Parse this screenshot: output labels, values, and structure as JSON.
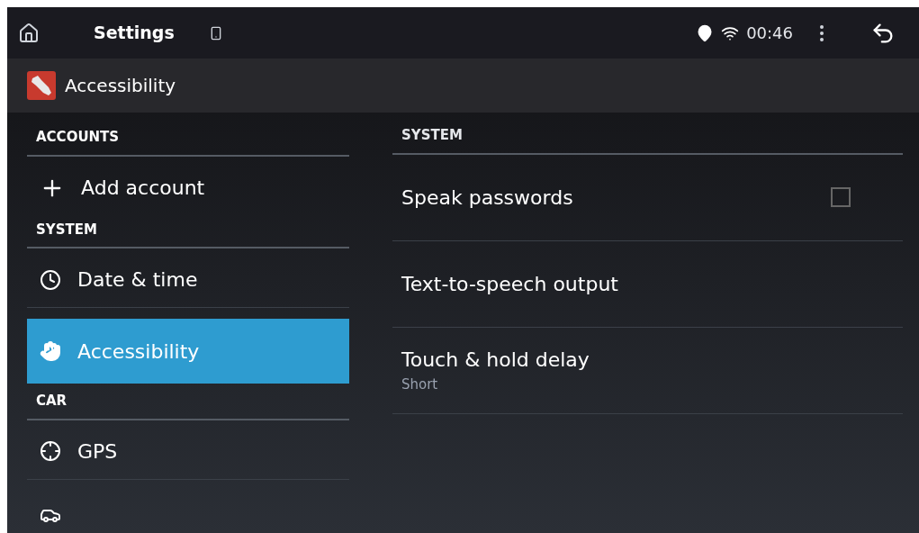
{
  "status_bar": {
    "title": "Settings",
    "time": "00:46"
  },
  "action_bar": {
    "title": "Accessibility"
  },
  "sidebar": {
    "sections": [
      {
        "header": "ACCOUNTS",
        "items": [
          {
            "kind": "add",
            "label": "Add account",
            "selected": false
          }
        ]
      },
      {
        "header": "SYSTEM",
        "items": [
          {
            "kind": "clock",
            "label": "Date & time",
            "selected": false
          },
          {
            "kind": "hand",
            "label": "Accessibility",
            "selected": true
          }
        ]
      },
      {
        "header": "CAR",
        "items": [
          {
            "kind": "gps",
            "label": "GPS",
            "selected": false
          },
          {
            "kind": "car",
            "selected": false
          }
        ]
      }
    ]
  },
  "content": {
    "header": "SYSTEM",
    "items": [
      {
        "kind": "checkbox",
        "title": "Speak passwords",
        "checked": false
      },
      {
        "kind": "plain",
        "title": "Text-to-speech output"
      },
      {
        "kind": "summary",
        "title": "Touch & hold delay",
        "summary": "Short"
      }
    ]
  }
}
